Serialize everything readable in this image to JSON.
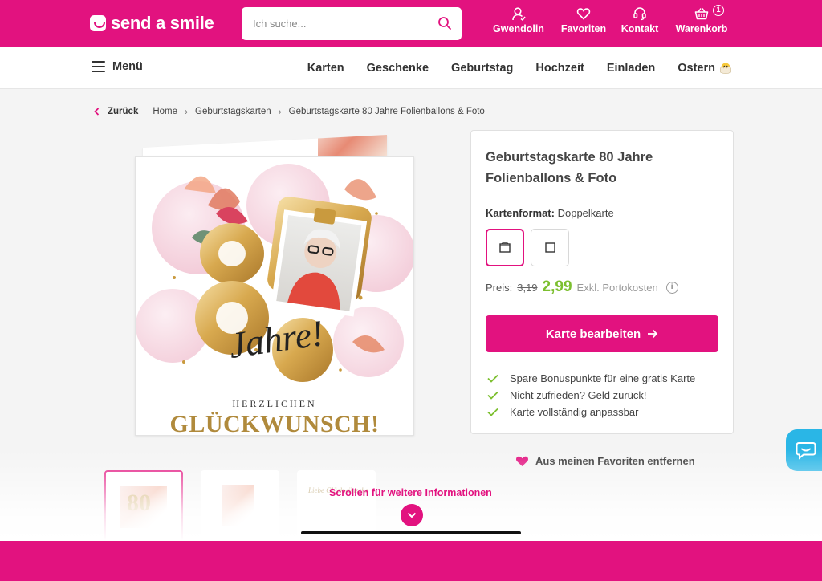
{
  "brand": {
    "name": "send a smile",
    "accent_color": "#e2127f",
    "price_color": "#7cbf2f",
    "chat_color": "#2ab6e6"
  },
  "search": {
    "placeholder": "Ich suche...",
    "icon": "search-icon"
  },
  "top_actions": [
    {
      "label": "Gwendolin",
      "icon": "user-icon"
    },
    {
      "label": "Favoriten",
      "icon": "heart-icon"
    },
    {
      "label": "Kontakt",
      "icon": "headset-icon"
    },
    {
      "label": "Warenkorb",
      "icon": "basket-icon",
      "badge": "1"
    }
  ],
  "nav": {
    "menu_label": "Menü",
    "links": [
      "Karten",
      "Geschenke",
      "Geburtstag",
      "Hochzeit",
      "Einladen",
      "Ostern"
    ]
  },
  "breadcrumb": {
    "back": "Zurück",
    "items": [
      "Home",
      "Geburtstagskarten",
      "Geburtstagskarte 80 Jahre Folienballons & Foto"
    ]
  },
  "card_preview": {
    "number": "80",
    "script": "Jahre!",
    "greeting_small": "HERZLICHEN",
    "greeting_big": "GLÜCKWUNSCH!"
  },
  "product": {
    "title": "Geburtstagskarte 80 Jahre Folienballons & Foto",
    "format_label": "Kartenformat:",
    "format_value": "Doppelkarte",
    "format_options": [
      {
        "icon": "double-card-icon",
        "selected": true
      },
      {
        "icon": "single-card-icon",
        "selected": false
      }
    ],
    "price_label": "Preis:",
    "price_old": "3,19",
    "price_new": "2,99",
    "price_note": "Exkl. Portokosten",
    "edit_button": "Karte bearbeiten",
    "benefits": [
      "Spare Bonuspunkte für eine gratis Karte",
      "Nicht zufrieden? Geld zurück!",
      "Karte vollständig anpassbar"
    ]
  },
  "favorite": {
    "label": "Aus meinen Favoriten entfernen"
  },
  "thumbnails": {
    "thumb_number": "80",
    "inside_text": "Liebe Glückwünsche"
  },
  "scroll_hint": "Scrollen für weitere Informationen"
}
